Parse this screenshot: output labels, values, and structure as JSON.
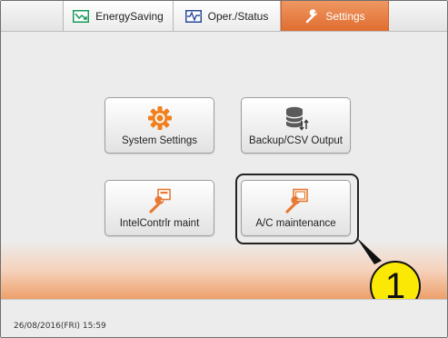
{
  "tabs": [
    {
      "label": "EnergySaving",
      "icon": "energy-saving-icon",
      "active": false
    },
    {
      "label": "Oper./Status",
      "icon": "pulse-icon",
      "active": false
    },
    {
      "label": "Settings",
      "icon": "wrench-icon",
      "active": true
    }
  ],
  "buttons": {
    "system_settings": {
      "label": "System Settings",
      "icon": "gear-icon"
    },
    "backup_csv": {
      "label": "Backup/CSV Output",
      "icon": "database-icon"
    },
    "intel_maint": {
      "label": "IntelContrlr maint",
      "icon": "controller-maintenance-icon"
    },
    "ac_maint": {
      "label": "A/C maintenance",
      "icon": "ac-maintenance-icon"
    }
  },
  "callout": {
    "number": "1"
  },
  "status": {
    "datetime": "26/08/2016(FRI) 15:59"
  },
  "colors": {
    "accent": "#e77a3d",
    "callout": "#fbe805",
    "gear": "#f0801f"
  }
}
